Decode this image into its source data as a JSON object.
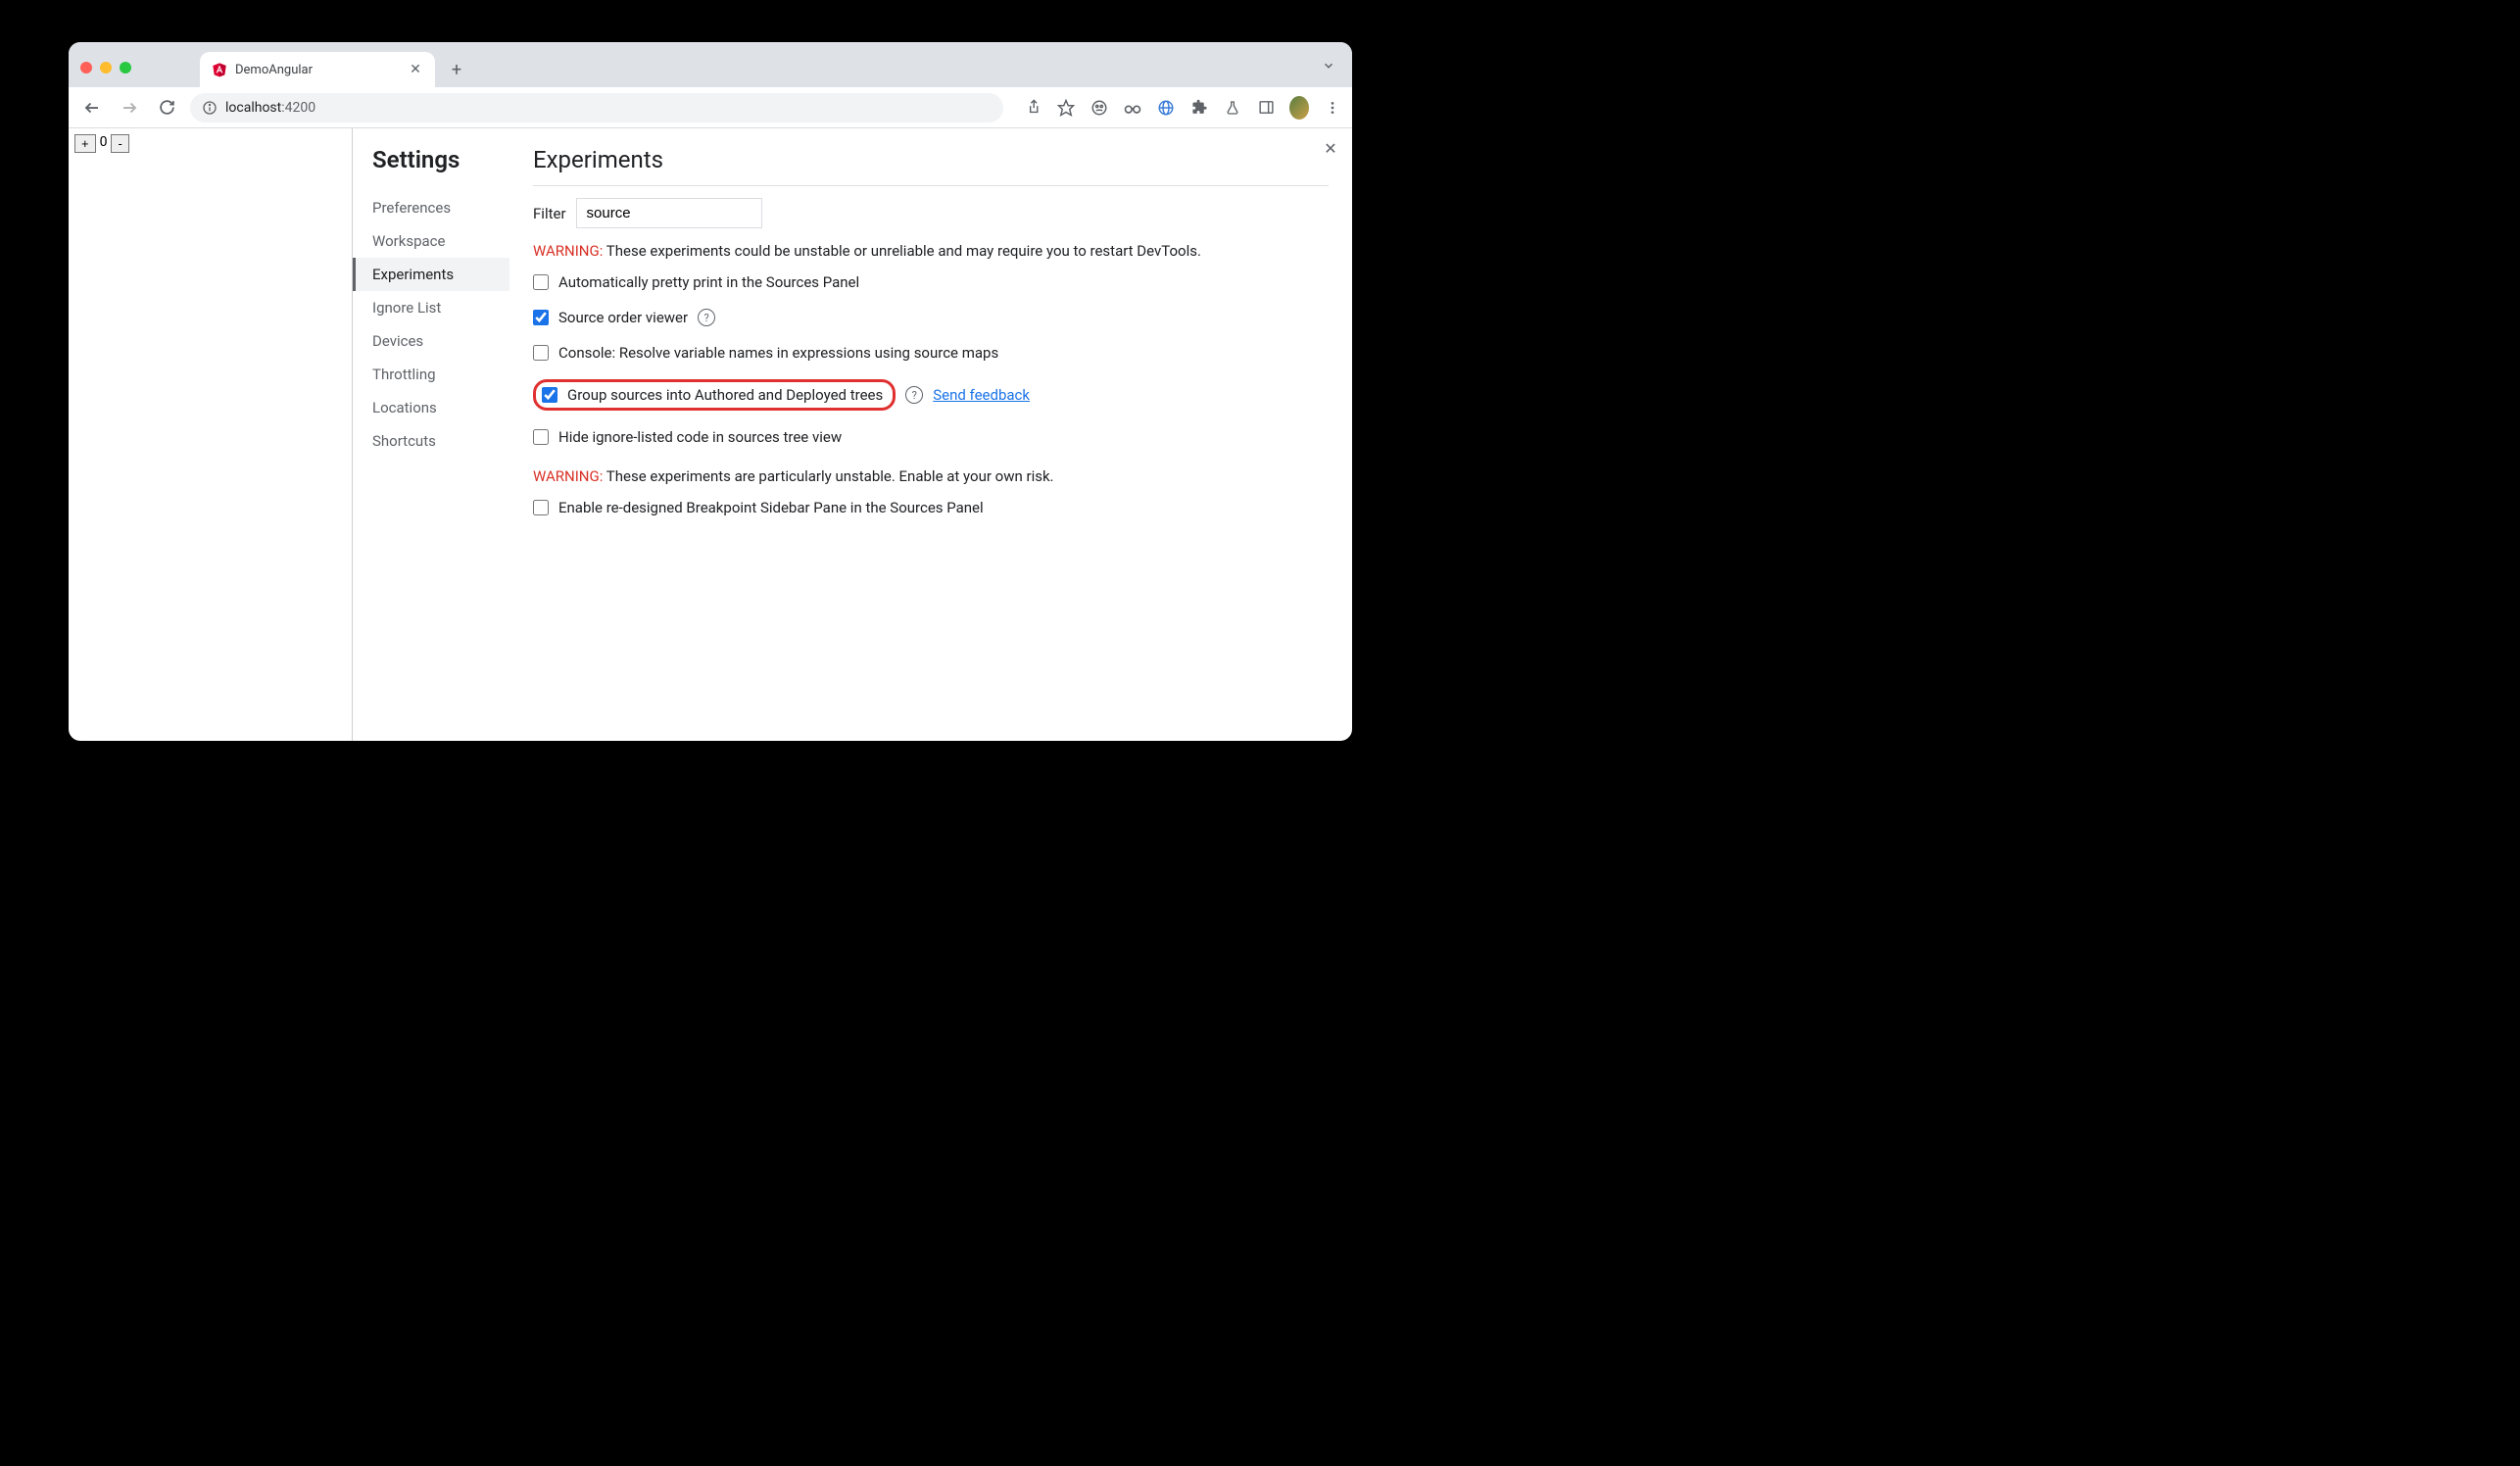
{
  "tab": {
    "title": "DemoAngular"
  },
  "url": {
    "host": "localhost",
    "port": ":4200"
  },
  "page": {
    "counter": "0"
  },
  "settings": {
    "title": "Settings",
    "items": [
      "Preferences",
      "Workspace",
      "Experiments",
      "Ignore List",
      "Devices",
      "Throttling",
      "Locations",
      "Shortcuts"
    ],
    "active_index": 2
  },
  "experiments": {
    "title": "Experiments",
    "filter_label": "Filter",
    "filter_value": "source",
    "warning1_prefix": "WARNING:",
    "warning1_msg": " These experiments could be unstable or unreliable and may require you to restart DevTools.",
    "opts": [
      {
        "checked": false,
        "label": "Automatically pretty print in the Sources Panel",
        "help": false
      },
      {
        "checked": true,
        "label": "Source order viewer",
        "help": true
      },
      {
        "checked": false,
        "label": "Console: Resolve variable names in expressions using source maps",
        "help": false
      },
      {
        "checked": true,
        "label": "Group sources into Authored and Deployed trees",
        "help": true,
        "highlight": true,
        "feedback": true
      },
      {
        "checked": false,
        "label": "Hide ignore-listed code in sources tree view",
        "help": false
      }
    ],
    "feedback_label": "Send feedback",
    "warning2_prefix": "WARNING:",
    "warning2_msg": " These experiments are particularly unstable. Enable at your own risk.",
    "opts2": [
      {
        "checked": false,
        "label": "Enable re-designed Breakpoint Sidebar Pane in the Sources Panel"
      }
    ]
  }
}
